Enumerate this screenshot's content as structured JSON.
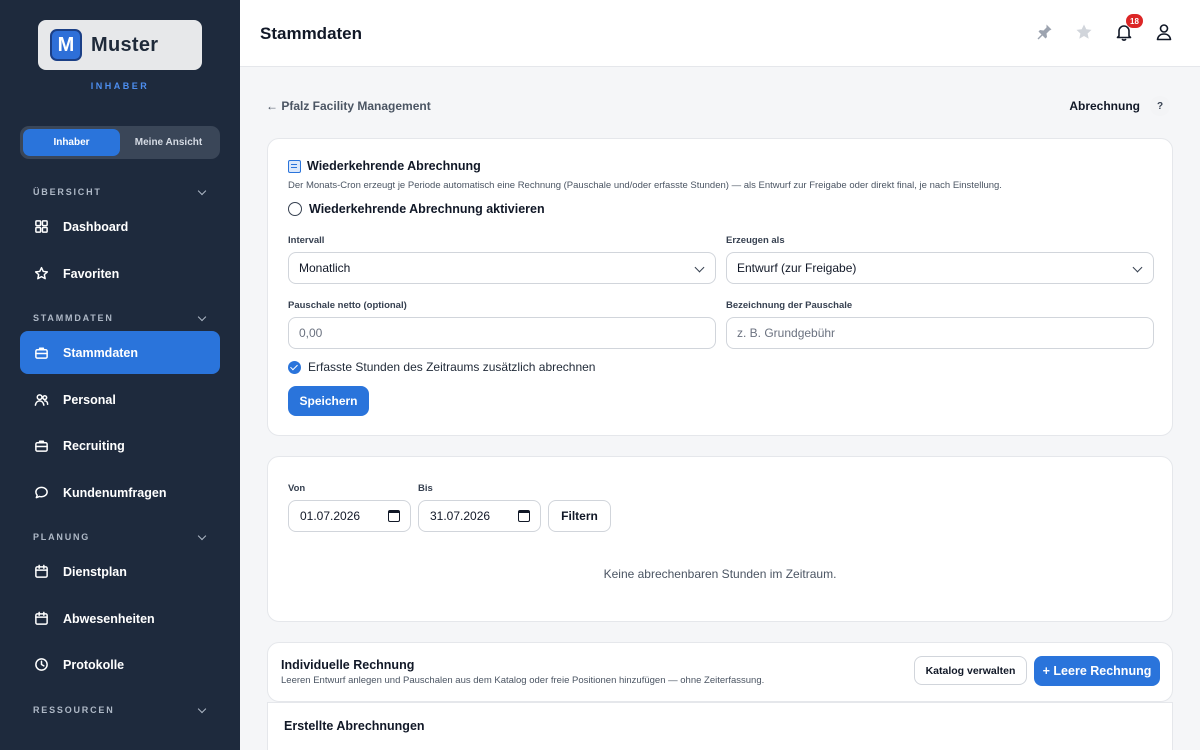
{
  "sidebar": {
    "logo_text": "Muster",
    "logo_letter": "M",
    "role": "INHABER",
    "view_toggle": {
      "active": "Inhaber",
      "other": "Meine Ansicht"
    },
    "sections": [
      {
        "label": "ÜBERSICHT",
        "items": [
          "Dashboard",
          "Favoriten"
        ]
      },
      {
        "label": "STAMMDATEN",
        "items": [
          "Stammdaten",
          "Personal",
          "Recruiting",
          "Kundenumfragen"
        ]
      },
      {
        "label": "PLANUNG",
        "items": [
          "Dienstplan",
          "Abwesenheiten",
          "Protokolle"
        ]
      },
      {
        "label": "RESSOURCEN",
        "items": []
      }
    ],
    "active_item": "Stammdaten"
  },
  "header": {
    "title": "Stammdaten",
    "notification_count": "18"
  },
  "breadcrumb": {
    "back": "← Pfalz Facility Management",
    "current": "Abrechnung",
    "help": "?"
  },
  "recurring": {
    "title": "Wiederkehrende Abrechnung",
    "description": "Der Monats-Cron erzeugt je Periode automatisch eine Rechnung (Pauschale und/oder erfasste Stunden) — als Entwurf zur Freigabe oder direkt final, je nach Einstellung.",
    "activate_label": "Wiederkehrende Abrechnung aktivieren",
    "activate_checked": false,
    "interval_label": "Intervall",
    "interval_value": "Monatlich",
    "create_as_label": "Erzeugen als",
    "create_as_value": "Entwurf (zur Freigabe)",
    "flat_net_label": "Pauschale netto (optional)",
    "flat_net_placeholder": "0,00",
    "flat_name_label": "Bezeichnung der Pauschale",
    "flat_name_placeholder": "z. B. Grundgebühr",
    "hours_label": "Erfasste Stunden des Zeitraums zusätzlich abrechnen",
    "hours_checked": true,
    "save_label": "Speichern"
  },
  "filter": {
    "from_label": "Von",
    "from_value": "01.07.2026",
    "to_label": "Bis",
    "to_value": "31.07.2026",
    "filter_label": "Filtern",
    "empty_message": "Keine abrechenbaren Stunden im Zeitraum."
  },
  "individual": {
    "title": "Individuelle Rechnung",
    "description": "Leeren Entwurf anlegen und Pauschalen aus dem Katalog oder freie Positionen hinzufügen — ohne Zeiterfassung.",
    "catalog_label": "Katalog verwalten",
    "new_label": "+ Leere Rechnung"
  },
  "created": {
    "title": "Erstellte Abrechnungen"
  },
  "colors": {
    "sidebar_bg": "#1e2a3d",
    "accent": "#2a74db",
    "badge": "#dc2626"
  }
}
